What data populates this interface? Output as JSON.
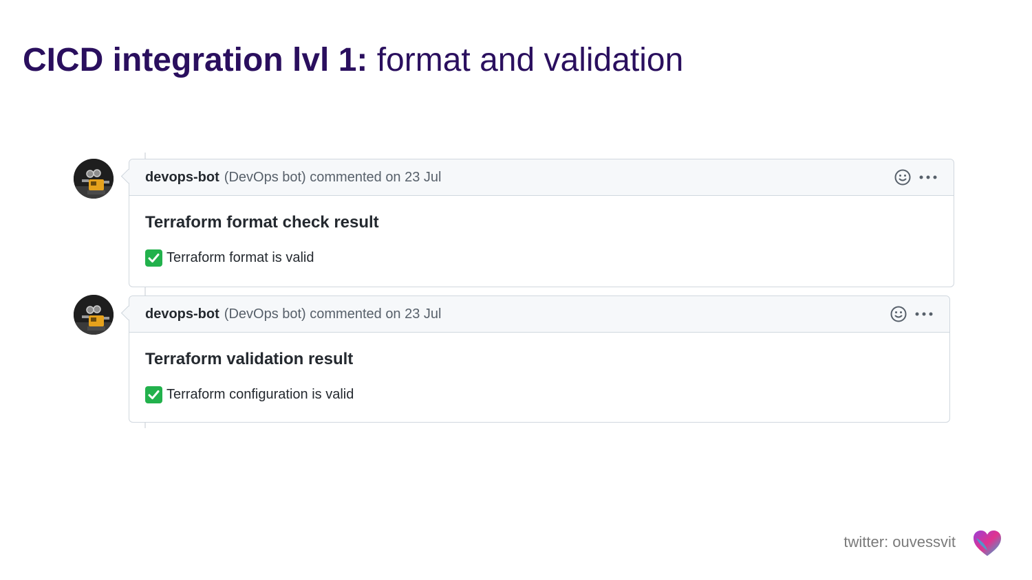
{
  "slide": {
    "title_bold": "CICD integration lvl 1:",
    "title_rest": " format and validation"
  },
  "comments": [
    {
      "author": "devops-bot",
      "meta": "(DevOps bot) commented on 23 Jul",
      "heading": "Terraform format check result",
      "result_text": "Terraform format is valid",
      "result_icon": "white-check-mark-icon"
    },
    {
      "author": "devops-bot",
      "meta": "(DevOps bot) commented on 23 Jul",
      "heading": "Terraform validation result",
      "result_text": "Terraform configuration is valid",
      "result_icon": "white-check-mark-icon"
    }
  ],
  "footer": {
    "handle": "twitter: ouvessvit",
    "logo_icon": "heart-logo-icon"
  },
  "colors": {
    "title": "#2a0f5e",
    "check": "#22b14c",
    "header_bg": "#f6f8fa",
    "border": "#d0d7de"
  }
}
